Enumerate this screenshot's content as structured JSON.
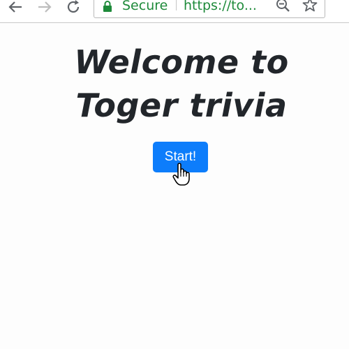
{
  "browser": {
    "security_label": "Secure",
    "url": "https://to...",
    "colors": {
      "secure_green": "#1e8a3a"
    },
    "icons": [
      "back-arrow-icon",
      "forward-arrow-icon",
      "reload-icon",
      "lock-icon",
      "zoom-out-icon",
      "bookmark-star-icon"
    ]
  },
  "page": {
    "title_line1": "Welcome to",
    "title_line2": "Toger trivia",
    "start_button_label": "Start!",
    "colors": {
      "primary": "#0d7dfb",
      "heading": "#22262b"
    }
  },
  "cursor": {
    "type": "hand-pointer-icon"
  }
}
